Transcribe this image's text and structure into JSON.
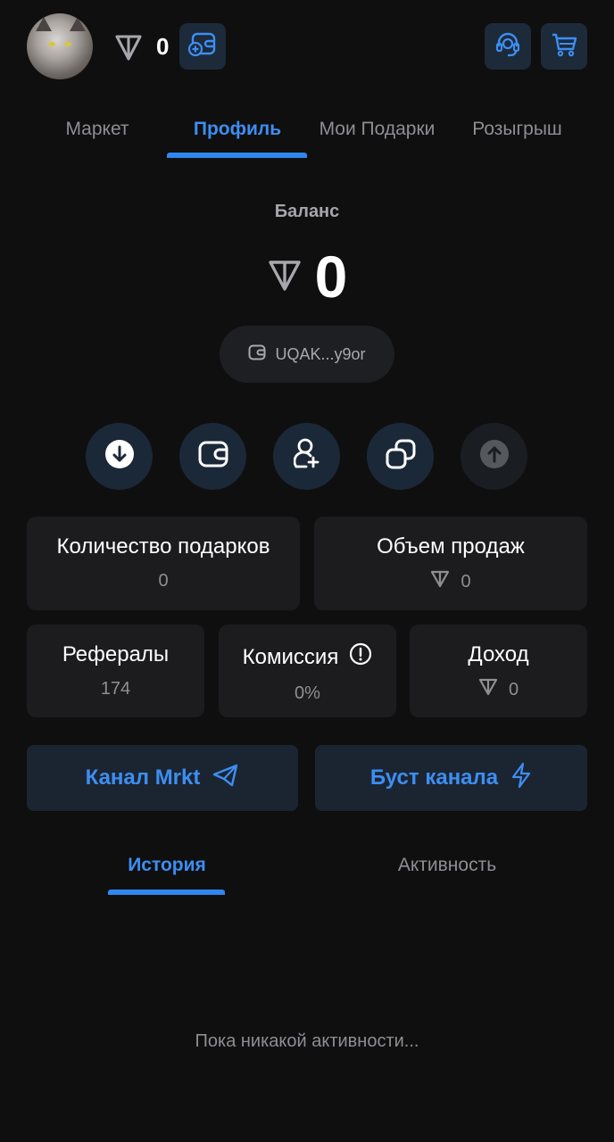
{
  "header": {
    "balance": "0",
    "icons": {
      "ton": "ton-icon",
      "wallet_add": "wallet-add-icon",
      "support": "support-icon",
      "cart": "cart-icon"
    }
  },
  "tabs": [
    {
      "label": "Маркет",
      "active": false
    },
    {
      "label": "Профиль",
      "active": true
    },
    {
      "label": "Мои Подарки",
      "active": false
    },
    {
      "label": "Розыгрыш",
      "active": false
    }
  ],
  "balance": {
    "label": "Баланс",
    "value": "0",
    "address": "UQAK...y9or"
  },
  "actions": [
    {
      "icon": "deposit-icon"
    },
    {
      "icon": "wallet-icon"
    },
    {
      "icon": "add-user-icon"
    },
    {
      "icon": "copy-icon"
    },
    {
      "icon": "withdraw-icon",
      "disabled": true
    }
  ],
  "stats": {
    "gifts_count": {
      "title": "Количество подарков",
      "value": "0"
    },
    "sales_volume": {
      "title": "Объем продаж",
      "value": "0"
    },
    "referrals": {
      "title": "Рефералы",
      "value": "174"
    },
    "commission": {
      "title": "Комиссия",
      "value": "0%"
    },
    "income": {
      "title": "Доход",
      "value": "0"
    }
  },
  "links": {
    "channel": "Канал Mrkt",
    "boost": "Буст канала"
  },
  "bottom_tabs": [
    {
      "label": "История",
      "active": true
    },
    {
      "label": "Активность",
      "active": false
    }
  ],
  "empty_state": "Пока никакой активности...",
  "colors": {
    "background": "#0f0f10",
    "accent": "#3d8ef2",
    "card": "#1c1c1f",
    "button_bg": "#1b2838"
  }
}
